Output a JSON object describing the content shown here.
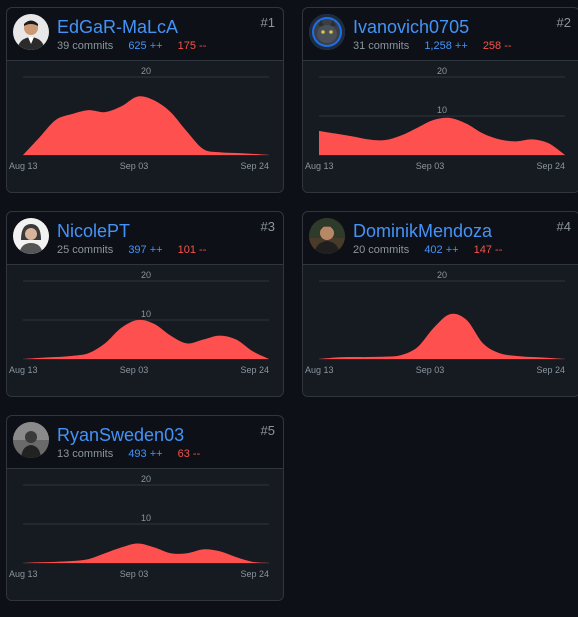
{
  "colors": {
    "background": "#0d1117",
    "chart_background": "#161b22",
    "username": "#4493f8",
    "additions": "#4493f8",
    "deletions": "#f85149",
    "area_fill": "#ff5050",
    "grid": "#30363d"
  },
  "contributors": [
    {
      "rank": "#1",
      "username": "EdGaR-MaLcA",
      "commits": "39 commits",
      "additions": "625 ++",
      "deletions": "175 --",
      "avatar": "avatar-photo-person",
      "chart_data": {
        "type": "area",
        "x_ticks": [
          "Aug 13",
          "Sep 03",
          "Sep 24"
        ],
        "y_ticks": [
          "20"
        ],
        "ylim": [
          0,
          20
        ],
        "values": [
          0,
          4.5,
          9,
          10.5,
          11.5,
          11,
          12.5,
          15,
          14,
          11,
          6,
          1.5,
          0.7,
          0.5,
          0.3,
          0
        ]
      }
    },
    {
      "rank": "#2",
      "username": "Ivanovich0705",
      "commits": "31 commits",
      "additions": "1,258 ++",
      "deletions": "258 --",
      "avatar": "avatar-photo-cat",
      "chart_data": {
        "type": "area",
        "x_ticks": [
          "Aug 13",
          "Sep 03",
          "Sep 24"
        ],
        "y_ticks": [
          "20",
          "10"
        ],
        "ylim": [
          0,
          20
        ],
        "values": [
          6.2,
          5.5,
          4.8,
          4,
          3.8,
          5,
          7,
          9,
          9.5,
          8,
          5.5,
          4,
          3.5,
          4,
          3,
          0
        ]
      }
    },
    {
      "rank": "#3",
      "username": "NicolePT",
      "commits": "25 commits",
      "additions": "397 ++",
      "deletions": "101 --",
      "avatar": "avatar-photo-person",
      "chart_data": {
        "type": "area",
        "x_ticks": [
          "Aug 13",
          "Sep 03",
          "Sep 24"
        ],
        "y_ticks": [
          "20",
          "10"
        ],
        "ylim": [
          0,
          20
        ],
        "values": [
          0,
          0.3,
          0.5,
          0.8,
          1.5,
          4,
          8,
          10,
          9,
          6,
          4,
          5,
          6,
          5,
          2,
          0
        ]
      }
    },
    {
      "rank": "#4",
      "username": "DominikMendoza",
      "commits": "20 commits",
      "additions": "402 ++",
      "deletions": "147 --",
      "avatar": "avatar-photo-person",
      "chart_data": {
        "type": "area",
        "x_ticks": [
          "Aug 13",
          "Sep 03",
          "Sep 24"
        ],
        "y_ticks": [
          "20"
        ],
        "ylim": [
          0,
          20
        ],
        "values": [
          0,
          0.4,
          0.5,
          0.5,
          0.6,
          1,
          3,
          8,
          11.5,
          10,
          4,
          1.5,
          0.8,
          0.5,
          0.3,
          0
        ]
      }
    },
    {
      "rank": "#5",
      "username": "RyanSweden03",
      "commits": "13 commits",
      "additions": "493 ++",
      "deletions": "63 --",
      "avatar": "avatar-photo-person",
      "chart_data": {
        "type": "area",
        "x_ticks": [
          "Aug 13",
          "Sep 03",
          "Sep 24"
        ],
        "y_ticks": [
          "20",
          "10"
        ],
        "ylim": [
          0,
          20
        ],
        "values": [
          0,
          0.2,
          0.3,
          0.5,
          1,
          2.5,
          4,
          5,
          4,
          2.5,
          2.5,
          3.5,
          3,
          1.5,
          0.3,
          0
        ]
      }
    }
  ]
}
